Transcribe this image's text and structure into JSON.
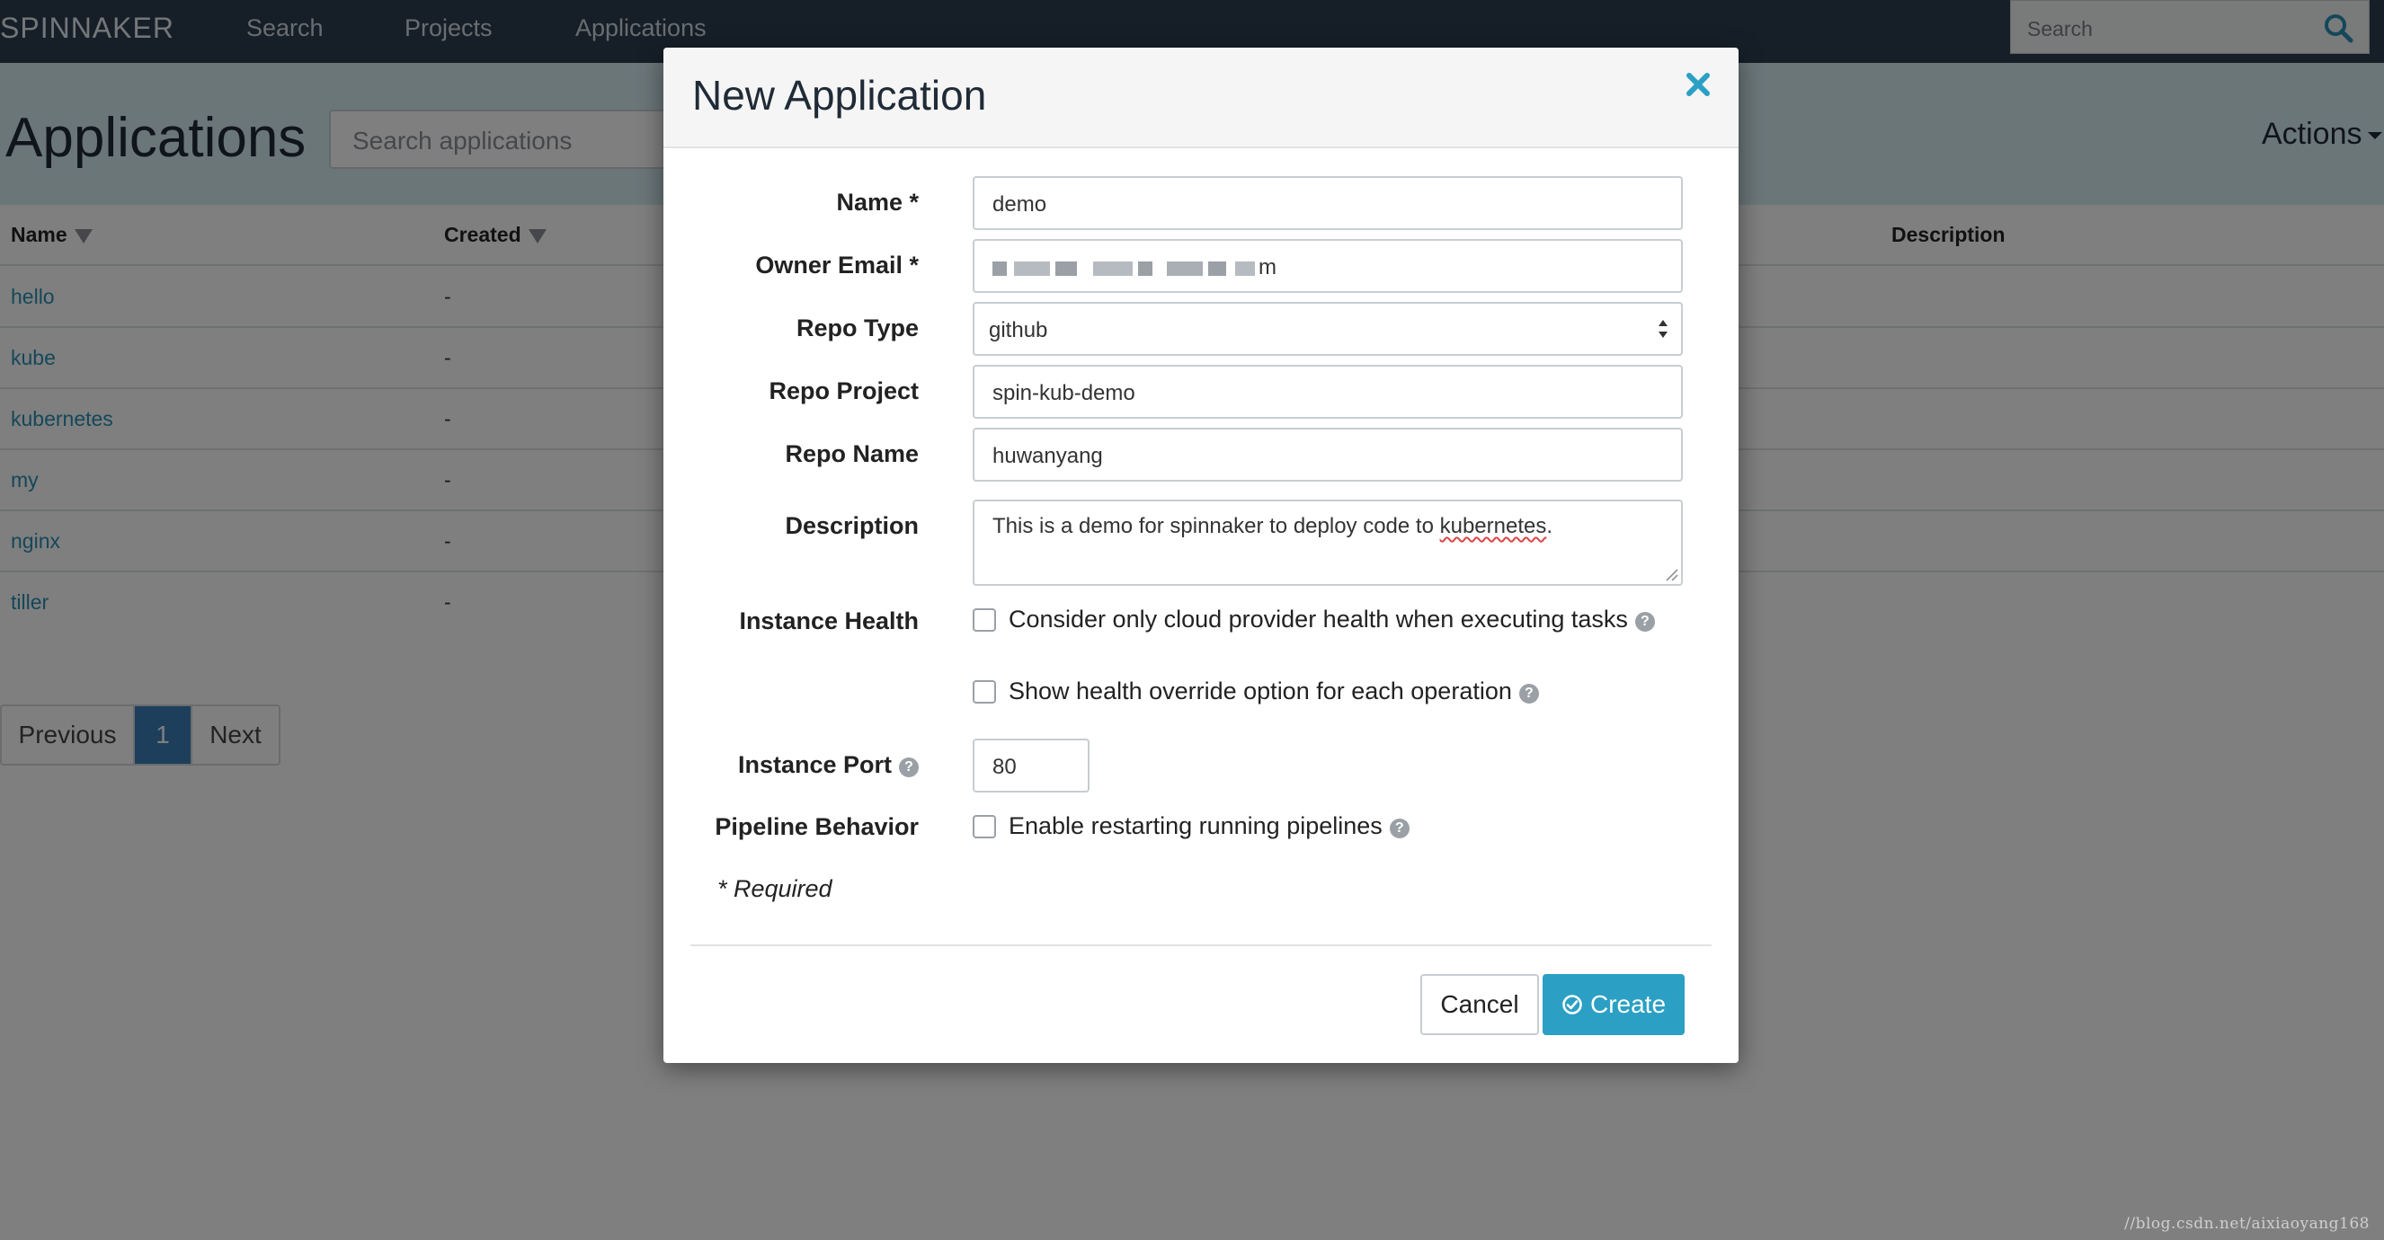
{
  "navbar": {
    "brand": "SPINNAKER",
    "links": [
      "Search",
      "Projects",
      "Applications"
    ],
    "search_placeholder": "Search"
  },
  "page": {
    "title": "Applications",
    "search_placeholder": "Search applications",
    "actions_label": "Actions"
  },
  "table": {
    "columns": [
      "Name",
      "Created",
      "Description"
    ],
    "rows": [
      {
        "name": "hello",
        "created": "-"
      },
      {
        "name": "kube",
        "created": "-"
      },
      {
        "name": "kubernetes",
        "created": "-"
      },
      {
        "name": "my",
        "created": "-"
      },
      {
        "name": "nginx",
        "created": "-"
      },
      {
        "name": "tiller",
        "created": "-"
      }
    ]
  },
  "pagination": {
    "previous": "Previous",
    "current": "1",
    "next": "Next"
  },
  "modal": {
    "title": "New Application",
    "fields": {
      "name": {
        "label": "Name *",
        "value": "demo"
      },
      "owner_email": {
        "label": "Owner Email *",
        "value_tail": "m"
      },
      "repo_type": {
        "label": "Repo Type",
        "value": "github"
      },
      "repo_project": {
        "label": "Repo Project",
        "value": "spin-kub-demo"
      },
      "repo_name": {
        "label": "Repo Name",
        "value": "huwanyang"
      },
      "description": {
        "label": "Description",
        "value_prefix": "This is a demo for spinnaker to deploy code to ",
        "value_misspelled": "kubernetes",
        "value_suffix": "."
      },
      "instance_health": {
        "label": "Instance Health",
        "option1": "Consider only cloud provider health when executing tasks",
        "option2": "Show health override option for each operation"
      },
      "instance_port": {
        "label": "Instance Port",
        "value": "80"
      },
      "pipeline_behavior": {
        "label": "Pipeline Behavior",
        "option": "Enable restarting running pipelines"
      }
    },
    "required_note": "* Required",
    "cancel_label": "Cancel",
    "create_label": "Create"
  },
  "watermark": "//blog.csdn.net/aixiaoyang168",
  "colors": {
    "navbar": "#2c3e50",
    "header_band": "#d7ecf3",
    "link": "#2a8fb3",
    "primary": "#2ba0c4",
    "pagination_active": "#3b7fb8"
  }
}
